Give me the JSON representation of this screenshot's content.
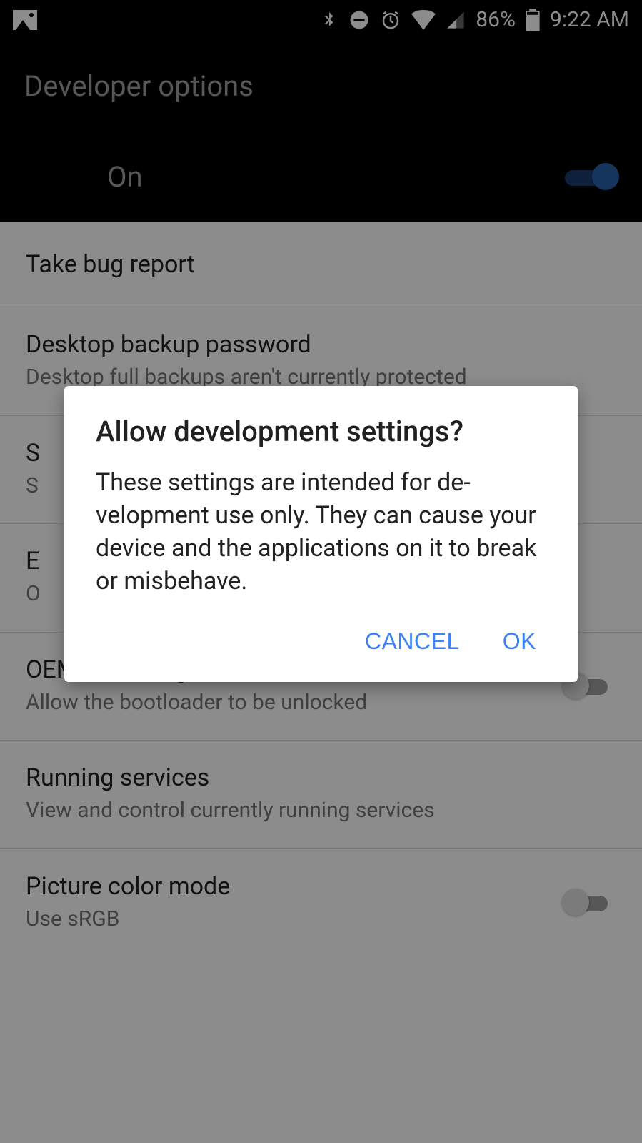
{
  "statusbar": {
    "battery_pct": "86%",
    "time": "9:22 AM"
  },
  "header": {
    "title": "Developer options"
  },
  "master": {
    "label": "On",
    "state": "on"
  },
  "rows": [
    {
      "title": "Take bug report",
      "sub": ""
    },
    {
      "title": "Desktop backup password",
      "sub": "Desktop full backups aren't currently protected"
    },
    {
      "title": "S",
      "sub": "S"
    },
    {
      "title": "E",
      "sub": "O"
    },
    {
      "title": "OEM unlocking",
      "sub": "Allow the bootloader to be unlocked",
      "toggle": "off"
    },
    {
      "title": "Running services",
      "sub": "View and control currently running services"
    },
    {
      "title": "Picture color mode",
      "sub": "Use sRGB",
      "toggle": "off"
    }
  ],
  "dialog": {
    "title": "Allow development settings?",
    "body": "These settings are intended for de­velopment use only. They can cause your device and the applications on it to break or misbehave.",
    "cancel": "CANCEL",
    "ok": "OK"
  }
}
